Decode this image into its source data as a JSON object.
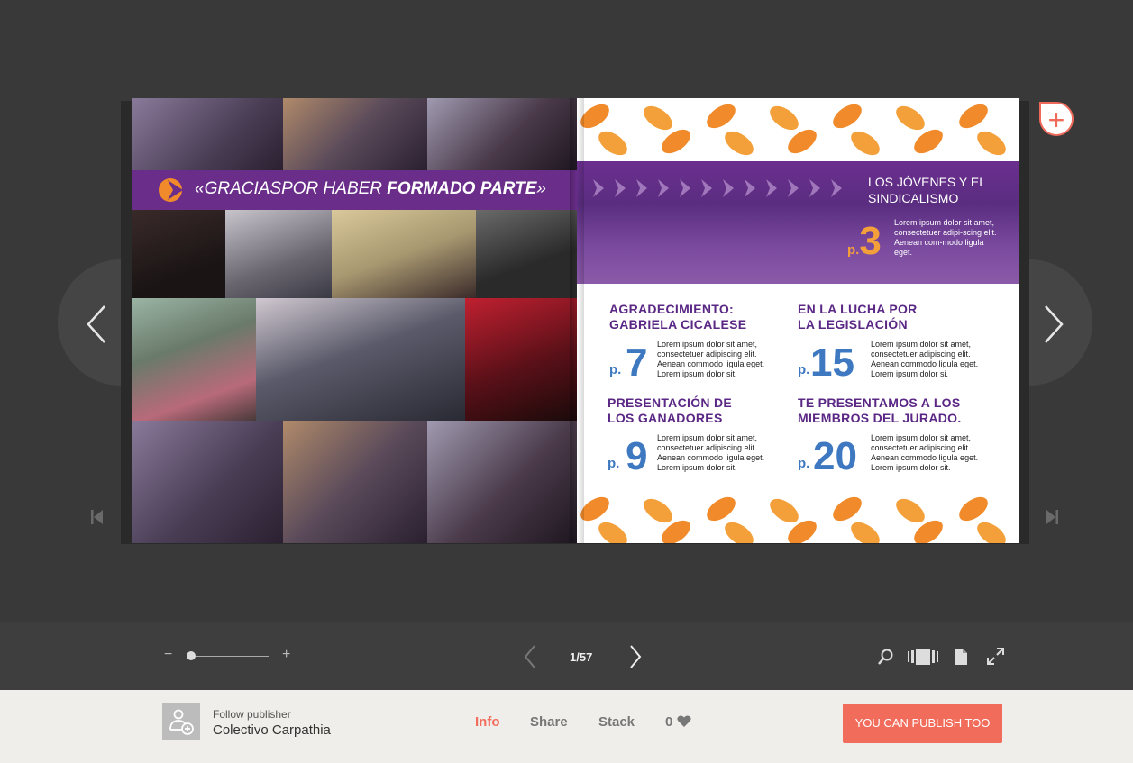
{
  "app": {
    "title": "Colectivo Carpathia"
  },
  "left_page": {
    "banner": {
      "quote_open": "«",
      "text_light": "GRACIASPOR HABER ",
      "text_bold": "FORMADO PARTE",
      "quote_close": "»"
    }
  },
  "right_page": {
    "band": {
      "title_line1": "LOS JÓVENES Y EL",
      "title_line2": "SINDICALISMO",
      "p_label": "p.",
      "page_num": "3",
      "lorem": "Lorem ipsum dolor sit amet, consectetuer adipi-scing elit. Aenean com-modo ligula eget."
    },
    "toc": [
      {
        "title_line1": "AGRADECIMIENTO:",
        "title_line2": "GABRIELA CICALESE",
        "p_label": "p.",
        "num": "7",
        "lorem": "Lorem ipsum dolor sit amet, consectetuer adipiscing elit. Aenean commodo ligula eget. Lorem ipsum dolor sit."
      },
      {
        "title_line1": "EN LA LUCHA POR",
        "title_line2": "LA LEGISLACIÓN",
        "p_label": "p.",
        "num": "15",
        "lorem": "Lorem ipsum dolor sit amet, consectetuer adipiscing elit. Aenean commodo ligula eget. Lorem ipsum dolor si."
      },
      {
        "title_line1": "PRESENTACIÓN DE",
        "title_line2": "LOS GANADORES",
        "p_label": "p.",
        "num": "9",
        "lorem": "Lorem ipsum dolor sit amet, consectetuer adipiscing elit. Aenean commodo ligula eget. Lorem ipsum dolor sit."
      },
      {
        "title_line1": "TE PRESENTAMOS A LOS",
        "title_line2": "MIEMBROS DEL JURADO.",
        "p_label": "p.",
        "num": "20",
        "lorem": "Lorem ipsum dolor sit amet, consectetuer adipiscing elit. Aenean commodo ligula eget. Lorem ipsum dolor sit."
      }
    ]
  },
  "toolbar": {
    "zoom_out": "−",
    "zoom_in": "+",
    "zoom_level": 0.0,
    "page_indicator": "1/57",
    "prev": "‹",
    "next": "›"
  },
  "footer": {
    "follow_label": "Follow publisher",
    "publisher_name": "Colectivo Carpathia",
    "tabs": {
      "info": "Info",
      "share": "Share",
      "stack": "Stack"
    },
    "likes": "0",
    "publish_button": "YOU CAN PUBLISH TOO"
  },
  "colors": {
    "accent": "#f26c5c",
    "purple": "#5a2785",
    "blue": "#3e78c0",
    "orange": "#f4a03a"
  },
  "icons": [
    "add-page-icon",
    "prev-page-icon",
    "next-page-icon",
    "first-page-icon",
    "last-page-icon",
    "search-icon",
    "thumbnails-icon",
    "single-page-icon",
    "fullscreen-icon",
    "follow-publisher-icon",
    "heart-icon"
  ]
}
